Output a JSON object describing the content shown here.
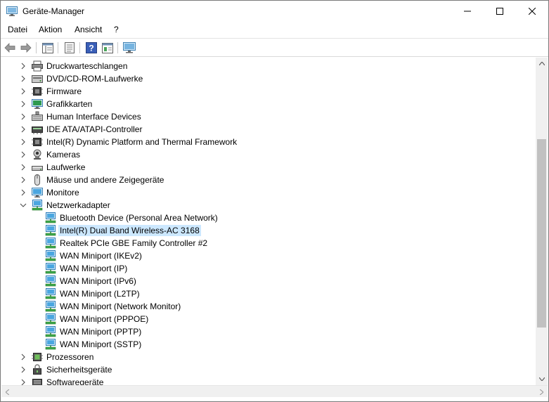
{
  "window": {
    "title": "Geräte-Manager"
  },
  "menu": [
    "Datei",
    "Aktion",
    "Ansicht",
    "?"
  ],
  "toolbar": {
    "buttons": [
      "back-arrow-icon",
      "forward-arrow-icon",
      "properties-view-icon",
      "details-icon",
      "help-icon",
      "device-properties-icon",
      "monitor-scan-icon"
    ]
  },
  "tree": {
    "top_categories": [
      {
        "label": "Druckwarteschlangen",
        "icon": "printer-icon"
      },
      {
        "label": "DVD/CD-ROM-Laufwerke",
        "icon": "disc-drive-icon"
      },
      {
        "label": "Firmware",
        "icon": "chip-icon"
      },
      {
        "label": "Grafikkarten",
        "icon": "display-adapter-icon"
      },
      {
        "label": "Human Interface Devices",
        "icon": "hid-icon"
      },
      {
        "label": "IDE ATA/ATAPI-Controller",
        "icon": "ide-controller-icon"
      },
      {
        "label": "Intel(R) Dynamic Platform and Thermal Framework",
        "icon": "chip-icon"
      },
      {
        "label": "Kameras",
        "icon": "camera-icon"
      },
      {
        "label": "Laufwerke",
        "icon": "drive-icon"
      },
      {
        "label": "Mäuse und andere Zeigegeräte",
        "icon": "mouse-icon"
      },
      {
        "label": "Monitore",
        "icon": "monitor-icon"
      }
    ],
    "expanded": {
      "label": "Netzwerkadapter",
      "icon": "network-adapter-icon",
      "children": [
        "Bluetooth Device (Personal Area Network)",
        "Intel(R) Dual Band Wireless-AC 3168",
        "Realtek PCIe GBE Family Controller #2",
        "WAN Miniport (IKEv2)",
        "WAN Miniport (IP)",
        "WAN Miniport (IPv6)",
        "WAN Miniport (L2TP)",
        "WAN Miniport (Network Monitor)",
        "WAN Miniport (PPPOE)",
        "WAN Miniport (PPTP)",
        "WAN Miniport (SSTP)"
      ],
      "selected_child": "Intel(R) Dual Band Wireless-AC 3168"
    },
    "bottom_categories": [
      {
        "label": "Prozessoren",
        "icon": "processor-icon"
      },
      {
        "label": "Sicherheitsgeräte",
        "icon": "security-device-icon"
      },
      {
        "label": "Softwaregeräte",
        "icon": "software-device-icon"
      }
    ]
  },
  "colors": {
    "selection": "#cce8ff",
    "network_icon": "#2a8ed6",
    "scroll_thumb": "#c1c1c1"
  }
}
